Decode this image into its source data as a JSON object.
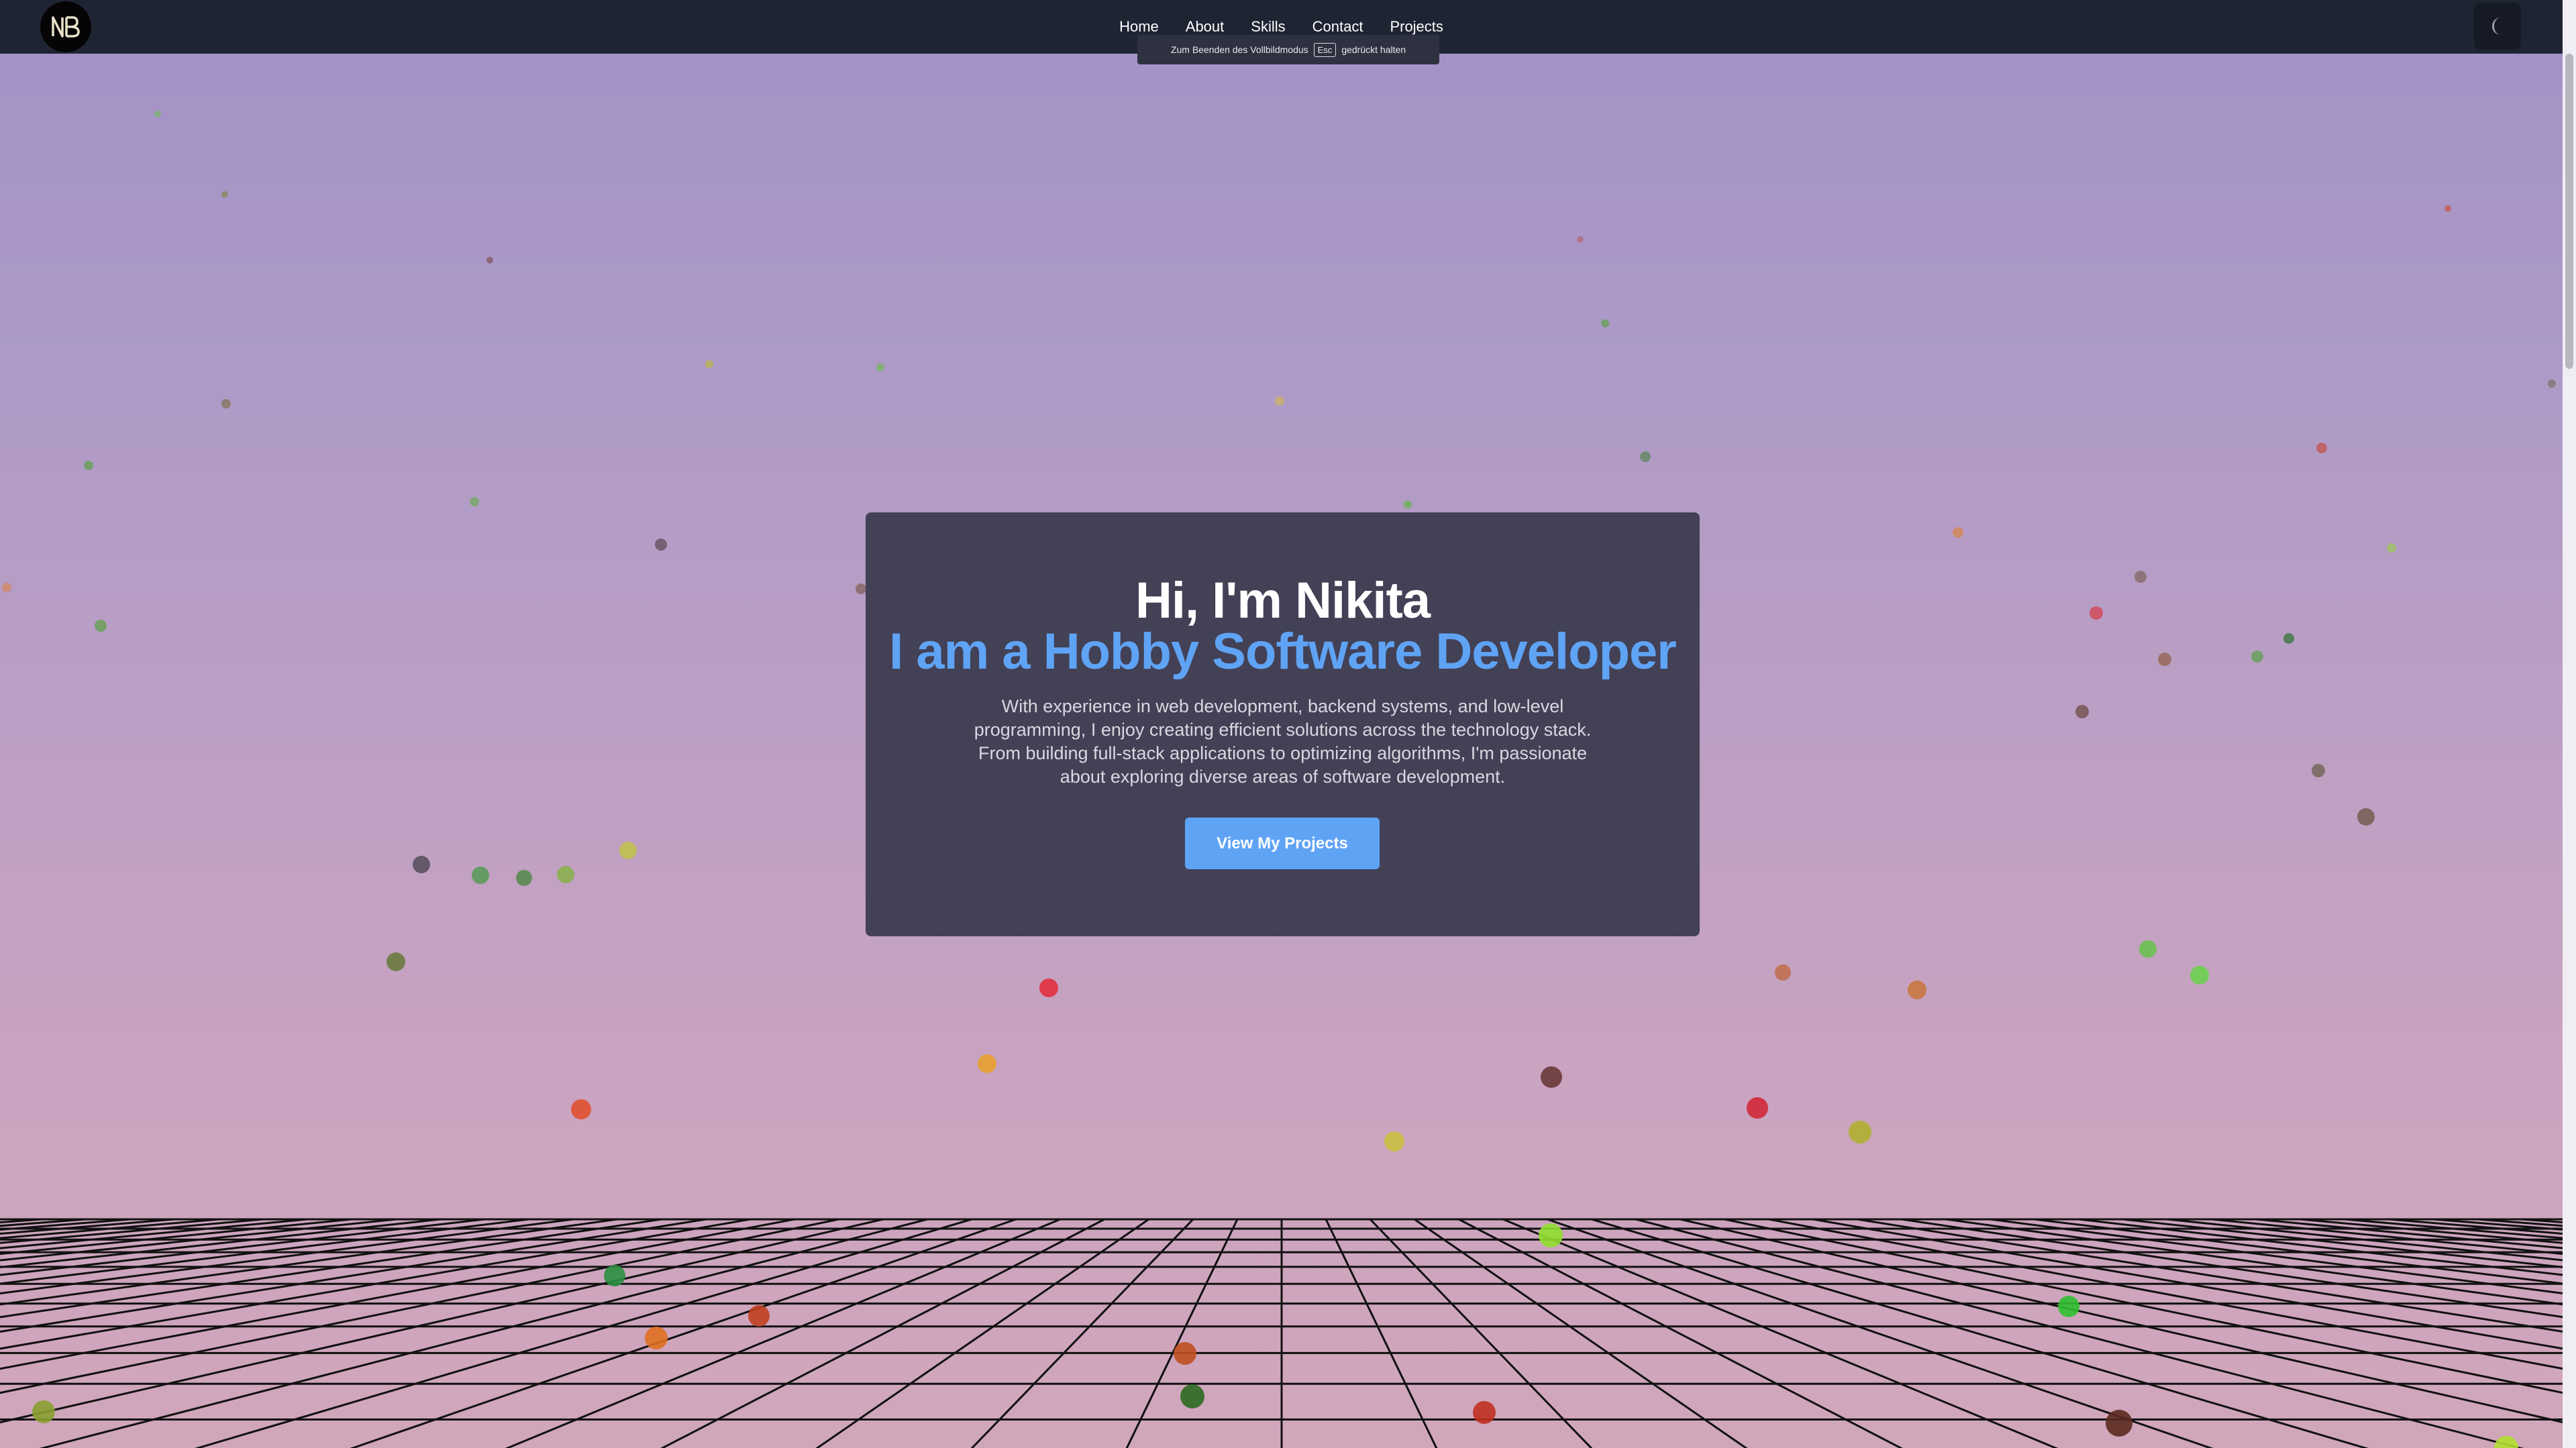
{
  "brand": {
    "logo_text": "NB"
  },
  "nav": {
    "items": [
      {
        "label": "Home"
      },
      {
        "label": "About"
      },
      {
        "label": "Skills"
      },
      {
        "label": "Contact"
      },
      {
        "label": "Projects"
      }
    ],
    "theme_toggle_icon": "moon-icon"
  },
  "fullscreen_notice": {
    "before": "Zum Beenden des Vollbildmodus",
    "key": "Esc",
    "after": "gedrückt halten"
  },
  "hero": {
    "greeting": "Hi, I'm Nikita",
    "role": "I am a Hobby Software Developer",
    "description": "With experience in web development, backend systems, and low-level programming, I enjoy creating efficient solutions across the technology stack. From building full-stack applications to optimizing algorithms, I'm passionate about exploring diverse areas of software development.",
    "cta_label": "View My Projects"
  },
  "colors": {
    "accent": "#5fa3f5",
    "navbar": "#1f2433",
    "card": "#3a3a4e"
  }
}
